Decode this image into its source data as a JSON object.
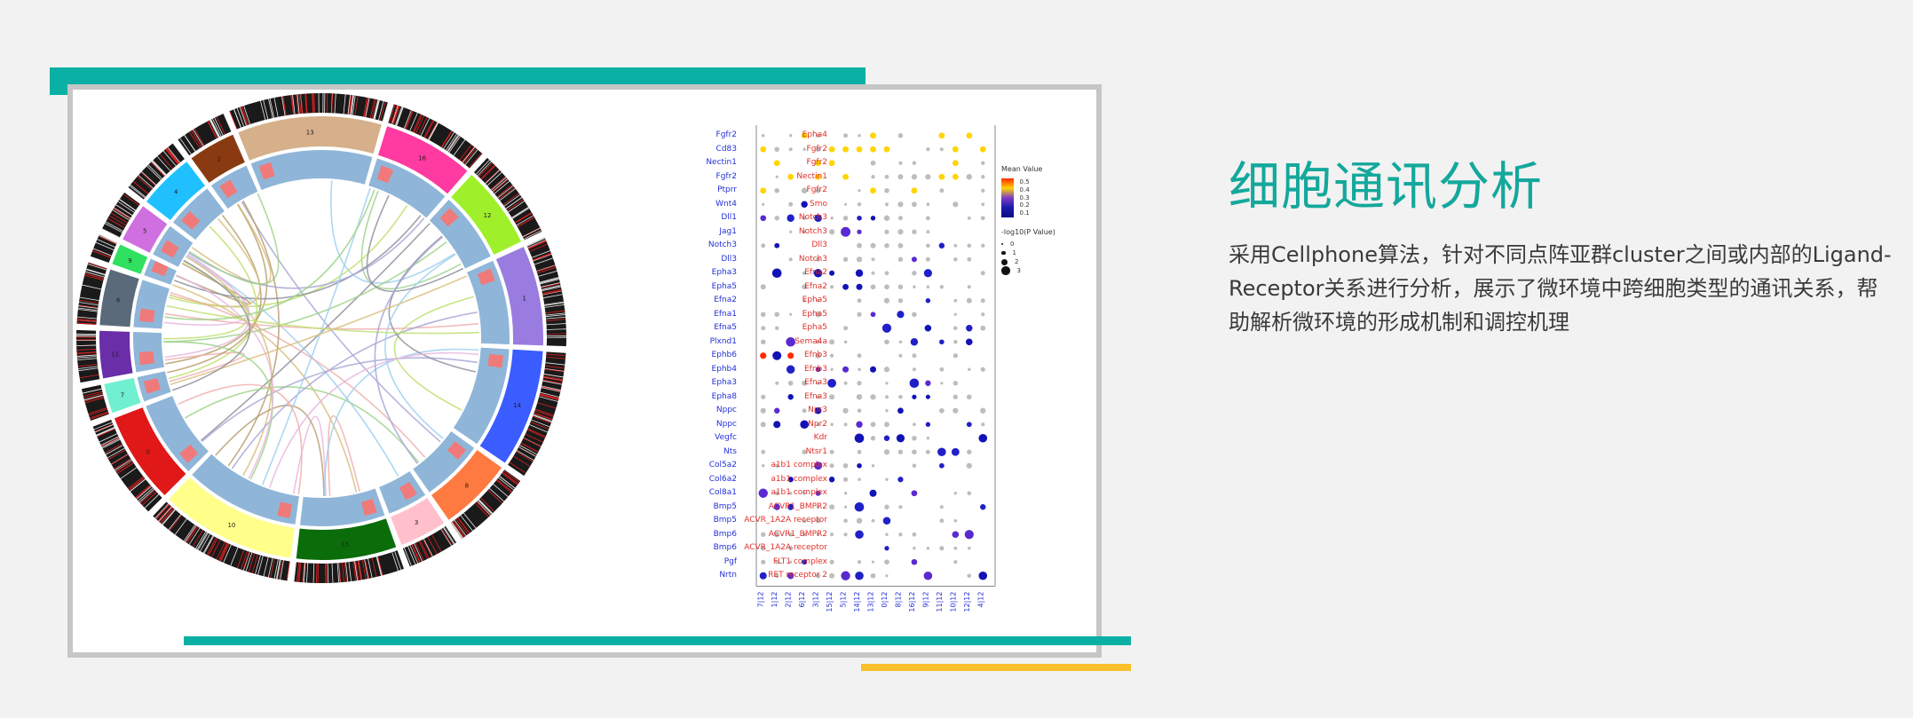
{
  "heading": {
    "title": "细胞通讯分析",
    "description": "采用Cellphone算法，针对不同点阵亚群cluster之间或内部的Ligand-Receptor关系进行分析，展示了微环境中跨细胞类型的通讯关系，帮助解析微环境的形成机制和调控机理"
  },
  "colors": {
    "accent_teal": "#0ab0a3",
    "accent_yellow": "#fbbf2a",
    "frame_gray": "#c6c6c6",
    "title_teal": "#14a89c"
  },
  "dotplot": {
    "ligands": [
      "Fgfr2",
      "Cd83",
      "Nectin1",
      "Fgfr2",
      "Ptprr",
      "Wnt4",
      "Dll1",
      "Jag1",
      "Notch3",
      "Dll3",
      "Epha3",
      "Epha5",
      "Efna2",
      "Efna1",
      "Efna5",
      "Plxnd1",
      "Ephb6",
      "Ephb4",
      "Epha3",
      "Epha8",
      "Nppc",
      "Nppc",
      "Vegfc",
      "Nts",
      "Col5a2",
      "Col6a2",
      "Col8a1",
      "Bmp5",
      "Bmp5",
      "Bmp6",
      "Bmp6",
      "Pgf",
      "Nrtn"
    ],
    "receptors": [
      "Epha4",
      "Fgfr2",
      "Fgfr2",
      "Nectin1",
      "Fgfr2",
      "Smo",
      "Notch3",
      "Notch3",
      "Dll3",
      "Notch3",
      "Efna2",
      "Efna2",
      "Epha5",
      "Epha5",
      "Epha5",
      "Sema4a",
      "Efnb3",
      "Efnb3",
      "Efna3",
      "Efna3",
      "Npr3",
      "Npr2",
      "Kdr",
      "Ntsr1",
      "a1b1 complex",
      "a1b1 complex",
      "a1b1 complex",
      "ACVR1_BMPR2",
      "ACVR_1A2A receptor",
      "ACVR1_BMPR2",
      "ACVR_1A2A receptor",
      "FLT1 complex",
      "RET receptor 2"
    ],
    "x_labels": [
      "7|12",
      "1|12",
      "2|12",
      "6|12",
      "3|12",
      "15|12",
      "5|12",
      "14|12",
      "13|12",
      "0|12",
      "8|12",
      "16|12",
      "9|12",
      "11|12",
      "10|12",
      "12|12",
      "4|12"
    ],
    "legend": {
      "mean_title": "Mean Value",
      "mean_ticks": [
        "0.5",
        "0.4",
        "0.3",
        "0.2",
        "0.1"
      ],
      "size_title": "-log10(P Value)",
      "size_ticks": [
        "0",
        "1",
        "2",
        "3"
      ]
    }
  },
  "circos": {
    "cluster_labels": [
      "13",
      "16",
      "12",
      "1",
      "14",
      "8",
      "3",
      "15",
      "10",
      "0",
      "7",
      "11",
      "6",
      "9",
      "5",
      "4",
      "2"
    ]
  }
}
